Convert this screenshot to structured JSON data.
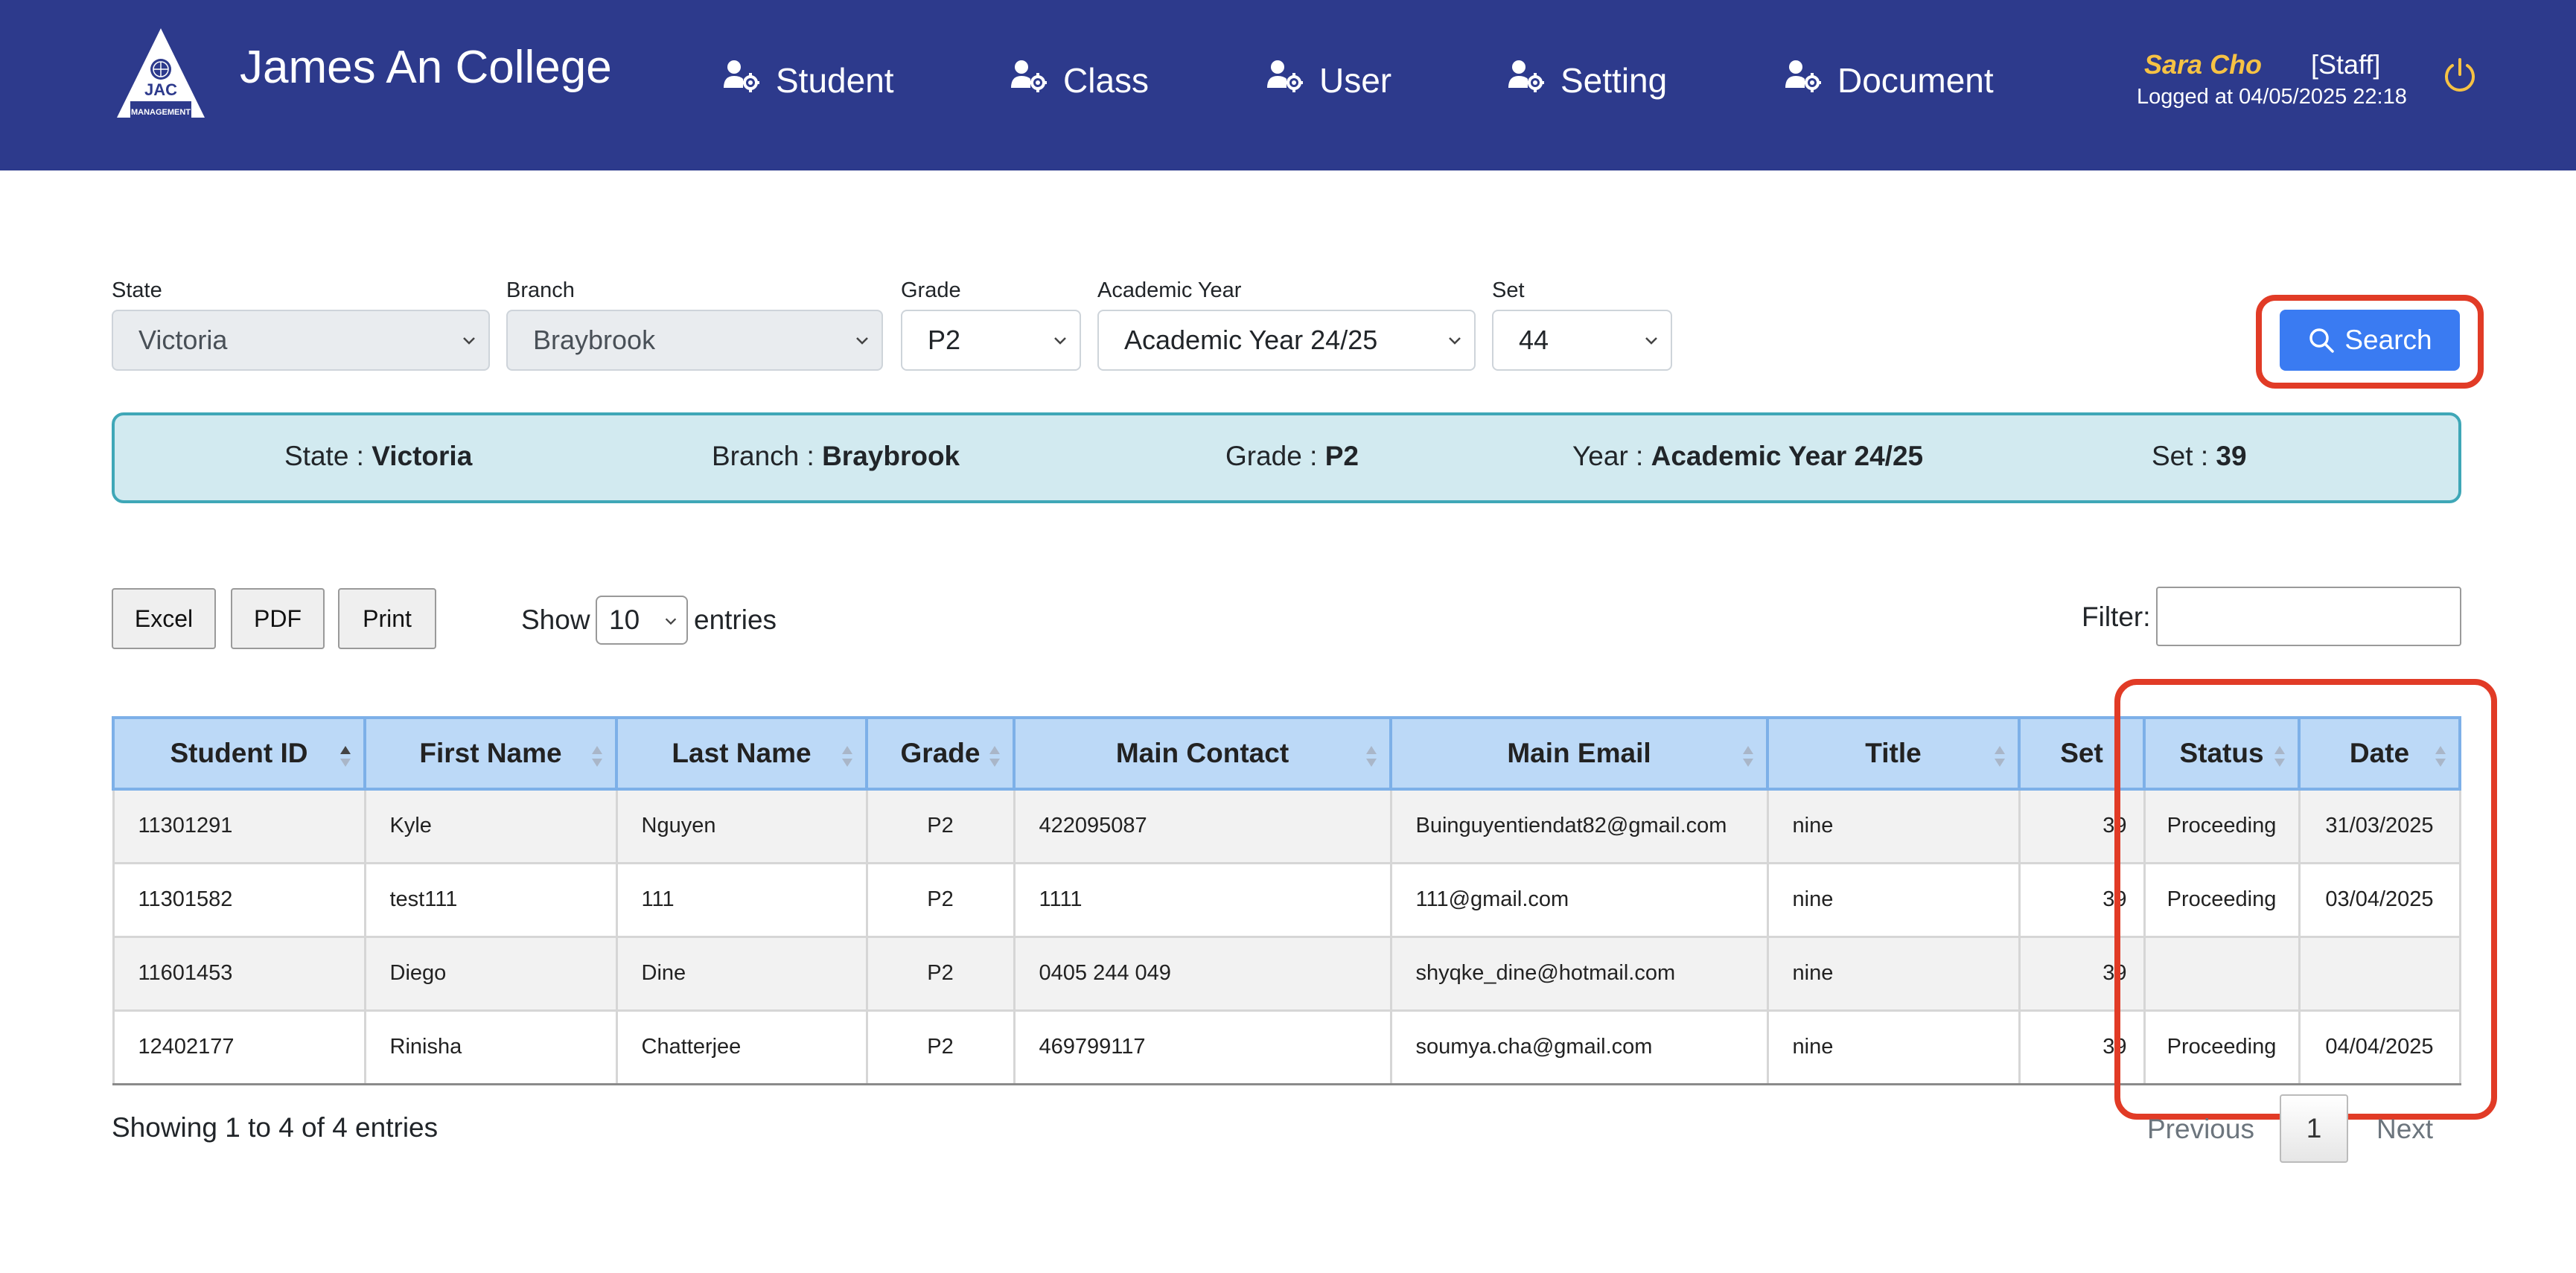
{
  "header": {
    "logo_text": "JAC",
    "logo_subtext": "MANAGEMENT",
    "brand": "James An College",
    "nav": [
      {
        "label": "Student"
      },
      {
        "label": "Class"
      },
      {
        "label": "User"
      },
      {
        "label": "Setting"
      },
      {
        "label": "Document"
      }
    ],
    "user": {
      "name": "Sara Cho",
      "role": "[Staff]",
      "logged": "Logged at 04/05/2025 22:18"
    }
  },
  "filters": {
    "state": {
      "label": "State",
      "value": "Victoria",
      "disabled": true
    },
    "branch": {
      "label": "Branch",
      "value": "Braybrook",
      "disabled": true
    },
    "grade": {
      "label": "Grade",
      "value": "P2"
    },
    "year": {
      "label": "Academic Year",
      "value": "Academic Year 24/25"
    },
    "set": {
      "label": "Set",
      "value": "44"
    },
    "search_label": "Search"
  },
  "summary": {
    "state_label": "State :",
    "state_value": "Victoria",
    "branch_label": "Branch :",
    "branch_value": "Braybrook",
    "grade_label": "Grade :",
    "grade_value": "P2",
    "year_label": "Year :",
    "year_value": "Academic Year 24/25",
    "set_label": "Set :",
    "set_value": "39"
  },
  "toolbar": {
    "excel": "Excel",
    "pdf": "PDF",
    "print": "Print",
    "show": "Show",
    "page_length": "10",
    "entries": "entries",
    "filter_label": "Filter:",
    "filter_value": ""
  },
  "table": {
    "columns": [
      "Student ID",
      "First Name",
      "Last Name",
      "Grade",
      "Main Contact",
      "Main Email",
      "Title",
      "Set",
      "Status",
      "Date"
    ],
    "rows": [
      [
        "11301291",
        "Kyle",
        "Nguyen",
        "P2",
        "422095087",
        "Buinguyentiendat82@gmail.com",
        "nine",
        "39",
        "Proceeding",
        "31/03/2025"
      ],
      [
        "11301582",
        "test111",
        "111",
        "P2",
        "1111",
        "111@gmail.com",
        "nine",
        "39",
        "Proceeding",
        "03/04/2025"
      ],
      [
        "11601453",
        "Diego",
        "Dine",
        "P2",
        "0405 244 049",
        "shyqke_dine@hotmail.com",
        "nine",
        "39",
        "",
        ""
      ],
      [
        "12402177",
        "Rinisha",
        "Chatterjee",
        "P2",
        "469799117",
        "soumya.cha@gmail.com",
        "nine",
        "39",
        "Proceeding",
        "04/04/2025"
      ]
    ]
  },
  "footer": {
    "info": "Showing 1 to 4 of 4 entries",
    "previous": "Previous",
    "current_page": "1",
    "next": "Next"
  },
  "colors": {
    "header_bg": "#2d3a8c",
    "accent_blue": "#3a7bf2",
    "highlight_red": "#e13b26",
    "username_gold": "#f6c244",
    "summary_bg": "#d2eaf0",
    "table_header_bg": "#bcd9f7"
  },
  "icons": [
    "logo-icon",
    "user-gear-icon",
    "power-icon",
    "chevron-down-icon",
    "search-icon",
    "sort-icon"
  ]
}
